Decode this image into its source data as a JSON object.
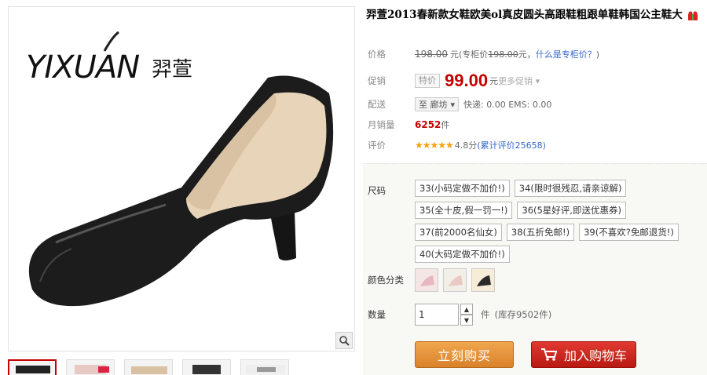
{
  "product": {
    "title": "羿萱2013春新款女鞋欧美ol真皮圆头高跟鞋粗跟单鞋韩国公主鞋大",
    "gift_icon": "gift-icon",
    "brand_logo": "yixuan-logo"
  },
  "price": {
    "label": "价格",
    "original": "198.00",
    "currency": "元",
    "counter_prefix": "(专柜价",
    "counter_value": "198.00",
    "counter_suffix": "元，",
    "counter_link": "什么是专柜价？",
    "counter_close": ")"
  },
  "promo": {
    "label": "促销",
    "tag": "特价",
    "price": "99.00",
    "currency": "元",
    "more": "更多促销"
  },
  "shipping": {
    "label": "配送",
    "to": "至 廊坊",
    "detail": "快递: 0.00 EMS: 0.00"
  },
  "sales": {
    "label": "月销量",
    "count": "6252",
    "unit": "件"
  },
  "rating": {
    "label": "评价",
    "stars": "★★★★★",
    "score": "4.8分",
    "reviews": "(累计评价25658)"
  },
  "sizes": {
    "label": "尺码",
    "options": [
      "33(小码定做不加价!)",
      "34(限时很残忍,请亲谅解)",
      "35(全十皮,假一罚一!)",
      "36(5星好评,即送优惠券)",
      "37(前2000名仙女)",
      "38(五折免邮!)",
      "39(不喜欢?免邮退货!)",
      "40(大码定做不加价!)"
    ]
  },
  "colors": {
    "label": "颜色分类"
  },
  "quantity": {
    "label": "数量",
    "value": "1",
    "unit": "件",
    "stock": "(库存9502件)"
  },
  "actions": {
    "buy_now": "立刻购买",
    "add_cart": "加入购物车"
  },
  "colors_theme": {
    "price_red": "#c40000",
    "buy_orange": "#e8913a",
    "cart_red": "#cc2a21"
  }
}
